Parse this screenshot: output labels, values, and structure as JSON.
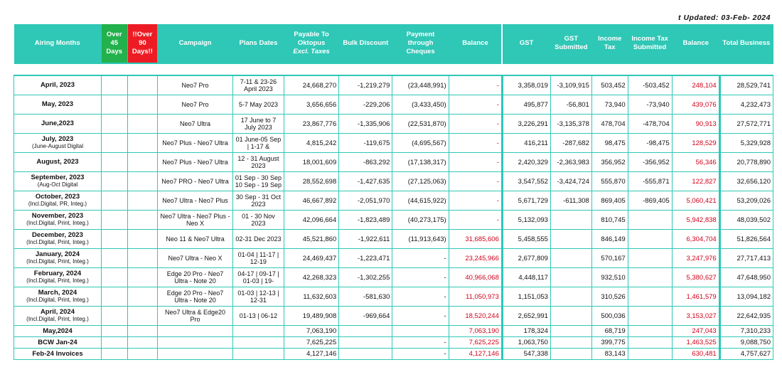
{
  "updated": "t Updated: 03-Feb- 2024",
  "headers": {
    "airing_months": "Airing Months",
    "over45": "Over 45 Days",
    "over90": "!!Over 90 Days!!",
    "campaign": "Campaign",
    "plans_dates": "Plans Dates",
    "payable_line1": "Payable To Oktopus",
    "payable_excl": "Excl. Taxes",
    "bulk_discount": "Bulk Discount",
    "payment_cheques": "Payment through Cheques",
    "balance": "Balance",
    "gst": "GST",
    "gst_submitted": "GST Submitted",
    "income_tax": "Income Tax",
    "income_tax_submitted": "Income Tax Submitted",
    "balance2": "Balance",
    "total_business": "Total Business"
  },
  "colors": {
    "teal": "#2fc7b6",
    "green": "#22b14c",
    "red": "#ed1c24",
    "red_text": "#d0021b"
  },
  "rows": [
    {
      "month": "April, 2023",
      "sub": "",
      "campaign": "Neo7 Pro",
      "plans": "7-11 & 23-26 April 2023",
      "payable": "24,668,270",
      "bulk": "-1,219,279",
      "cheques": "(23,448,991)",
      "balance": "-",
      "gst": "3,358,019",
      "gst_sub": "-3,109,915",
      "it": "503,452",
      "it_sub": "-503,452",
      "balance2": "248,104",
      "total": "28,529,741"
    },
    {
      "month": "May, 2023",
      "sub": "",
      "campaign": "Neo7 Pro",
      "plans": "5-7 May 2023",
      "payable": "3,656,656",
      "bulk": "-229,206",
      "cheques": "(3,433,450)",
      "balance": "-",
      "gst": "495,877",
      "gst_sub": "-56,801",
      "it": "73,940",
      "it_sub": "-73,940",
      "balance2": "439,076",
      "total": "4,232,473"
    },
    {
      "month": "June,2023",
      "sub": "",
      "campaign": "Neo7 Ultra",
      "plans": "17 June to 7 July 2023",
      "payable": "23,867,776",
      "bulk": "-1,335,906",
      "cheques": "(22,531,870)",
      "balance": "-",
      "gst": "3,226,291",
      "gst_sub": "-3,135,378",
      "it": "478,704",
      "it_sub": "-478,704",
      "balance2": "90,913",
      "total": "27,572,771"
    },
    {
      "month": "July, 2023",
      "sub": "(June-August Digital",
      "campaign": "Neo7 Plus - Neo7 Ultra",
      "plans": "01 June-05 Sep | 1-17 &",
      "payable": "4,815,242",
      "bulk": "-119,675",
      "cheques": "(4,695,567)",
      "balance": "-",
      "gst": "416,211",
      "gst_sub": "-287,682",
      "it": "98,475",
      "it_sub": "-98,475",
      "balance2": "128,529",
      "total": "5,329,928"
    },
    {
      "month": "August, 2023",
      "sub": "",
      "campaign": "Neo7 Plus - Neo7 Ultra",
      "plans": "12 - 31 August 2023",
      "payable": "18,001,609",
      "bulk": "-863,292",
      "cheques": "(17,138,317)",
      "balance": "-",
      "gst": "2,420,329",
      "gst_sub": "-2,363,983",
      "it": "356,952",
      "it_sub": "-356,952",
      "balance2": "56,346",
      "total": "20,778,890"
    },
    {
      "month": "September, 2023",
      "sub": "(Aug-Oct Digital",
      "campaign": "Neo7 PRO - Neo7 Ultra",
      "plans": "01 Sep - 30 Sep 10 Sep - 19 Sep",
      "payable": "28,552,698",
      "bulk": "-1,427,635",
      "cheques": "(27,125,063)",
      "balance": "-",
      "gst": "3,547,552",
      "gst_sub": "-3,424,724",
      "it": "555,870",
      "it_sub": "-555,871",
      "balance2": "122,827",
      "total": "32,656,120"
    },
    {
      "month": "October, 2023",
      "sub": "(Incl.Digital, PR, Integ.)",
      "campaign": "Neo7 Ultra - Neo7 Plus",
      "plans": "30 Sep - 31 Oct 2023",
      "payable": "46,667,892",
      "bulk": "-2,051,970",
      "cheques": "(44,615,922)",
      "balance": "-",
      "gst": "5,671,729",
      "gst_sub": "-611,308",
      "it": "869,405",
      "it_sub": "-869,405",
      "balance2": "5,060,421",
      "total": "53,209,026"
    },
    {
      "month": "November, 2023",
      "sub": "(Incl.Digital, Print, Integ.)",
      "campaign": "Neo7 Ultra - Neo7 Plus - Neo X",
      "plans": "01 - 30 Nov 2023",
      "payable": "42,096,664",
      "bulk": "-1,823,489",
      "cheques": "(40,273,175)",
      "balance": "-",
      "gst": "5,132,093",
      "gst_sub": "",
      "it": "810,745",
      "it_sub": "",
      "balance2": "5,942,838",
      "total": "48,039,502"
    },
    {
      "month": "December, 2023",
      "sub": "(Incl.Digital, Print, Integ.)",
      "campaign": "Neo 11 & Neo7 Ultra",
      "plans": "02-31 Dec 2023",
      "payable": "45,521,860",
      "bulk": "-1,922,611",
      "cheques": "(11,913,643)",
      "balance": "31,685,606",
      "gst": "5,458,555",
      "gst_sub": "",
      "it": "846,149",
      "it_sub": "",
      "balance2": "6,304,704",
      "total": "51,826,564"
    },
    {
      "month": "January, 2024",
      "sub": "(Incl.Digital, Print, Integ.)",
      "campaign": "Neo7 Ultra - Neo X",
      "plans": "01-04 | 11-17 | 12-19",
      "payable": "24,469,437",
      "bulk": "-1,223,471",
      "cheques": "-",
      "balance": "23,245,966",
      "gst": "2,677,809",
      "gst_sub": "",
      "it": "570,167",
      "it_sub": "",
      "balance2": "3,247,976",
      "total": "27,717,413"
    },
    {
      "month": "February, 2024",
      "sub": "(Incl.Digital, Print, Integ.)",
      "campaign": "Edge 20 Pro - Neo7 Ultra - Note 20",
      "plans": "04-17 | 09-17 | 01-03 | 19-",
      "payable": "42,268,323",
      "bulk": "-1,302,255",
      "cheques": "-",
      "balance": "40,966,068",
      "gst": "4,448,117",
      "gst_sub": "",
      "it": "932,510",
      "it_sub": "",
      "balance2": "5,380,627",
      "total": "47,648,950"
    },
    {
      "month": "March, 2024",
      "sub": "(Incl.Digital, Print, Integ.)",
      "campaign": "Edge 20 Pro - Neo7 Ultra - Note 20",
      "plans": "01-03 | 12-13 | 12-31",
      "payable": "11,632,603",
      "bulk": "-581,630",
      "cheques": "-",
      "balance": "11,050,973",
      "gst": "1,151,053",
      "gst_sub": "",
      "it": "310,526",
      "it_sub": "",
      "balance2": "1,461,579",
      "total": "13,094,182"
    },
    {
      "month": "April, 2024",
      "sub": "(Incl.Digital, Print, Integ.)",
      "campaign": "Neo7 Ultra & Edge20 Pro",
      "plans": "01-13 | 06-12",
      "payable": "19,489,908",
      "bulk": "-969,664",
      "cheques": "-",
      "balance": "18,520,244",
      "gst": "2,652,991",
      "gst_sub": "",
      "it": "500,036",
      "it_sub": "",
      "balance2": "3,153,027",
      "total": "22,642,935"
    }
  ],
  "short_rows": [
    {
      "month": "May,2024",
      "payable": "7,063,190",
      "cheques": "",
      "balance": "7,063,190",
      "gst": "178,324",
      "it": "68,719",
      "balance2": "247,043",
      "total": "7,310,233"
    },
    {
      "month": "BCW Jan-24",
      "payable": "7,625,225",
      "cheques": "-",
      "balance": "7,625,225",
      "gst": "1,063,750",
      "it": "399,775",
      "balance2": "1,463,525",
      "total": "9,088,750"
    },
    {
      "month": "Feb-24 Invoices",
      "payable": "4,127,146",
      "cheques": "-",
      "balance": "4,127,146",
      "gst": "547,338",
      "it": "83,143",
      "balance2": "630,481",
      "total": "4,757,627"
    }
  ]
}
